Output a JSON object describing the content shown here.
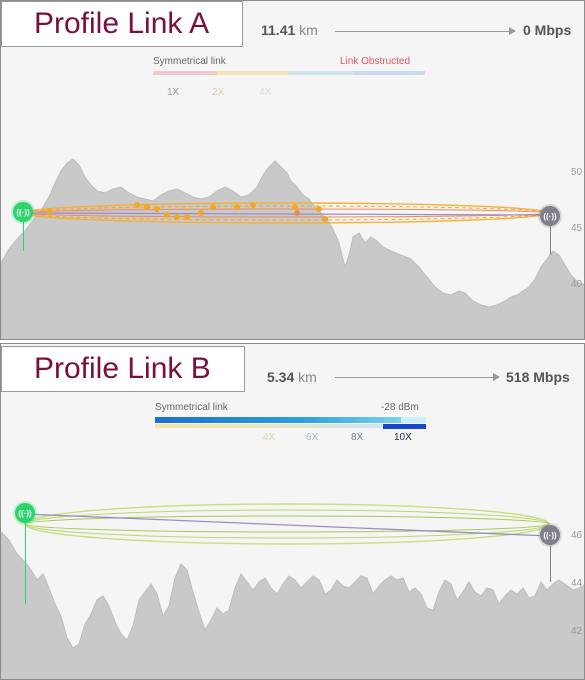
{
  "panel_a": {
    "title": "Profile Link A",
    "distance_value": "11.41",
    "distance_unit": "km",
    "throughput": "0 Mbps",
    "legend_left": "Symmetrical link",
    "legend_right": "Link Obstructed",
    "modulation_ticks": [
      "1X",
      "2X",
      "4X"
    ],
    "elevation_ticks": [
      "50",
      "45",
      "40"
    ],
    "tx_icon": "radio-icon",
    "rx_icon": "radio-icon"
  },
  "panel_b": {
    "title": "Profile Link B",
    "distance_value": "5.34",
    "distance_unit": "km",
    "throughput": "518 Mbps",
    "legend_left": "Symmetrical link",
    "legend_right": "-28 dBm",
    "modulation_ticks": [
      "4X",
      "6X",
      "8X",
      "10X"
    ],
    "active_tick": "10X",
    "elevation_ticks": [
      "46",
      "44",
      "42"
    ],
    "tx_icon": "radio-icon",
    "rx_icon": "radio-icon"
  },
  "colors": {
    "title": "#7a0f3f",
    "terrain": "#c9c9c9",
    "fresnel_obstructed": "#f5a623",
    "fresnel_clear": "#b8d86b",
    "link_line": "#9a8fc0",
    "node_green": "#2bd56b",
    "node_gray": "#7f8088",
    "bar_blue": "#1f8bd6",
    "bar_active": "#1748c9"
  }
}
